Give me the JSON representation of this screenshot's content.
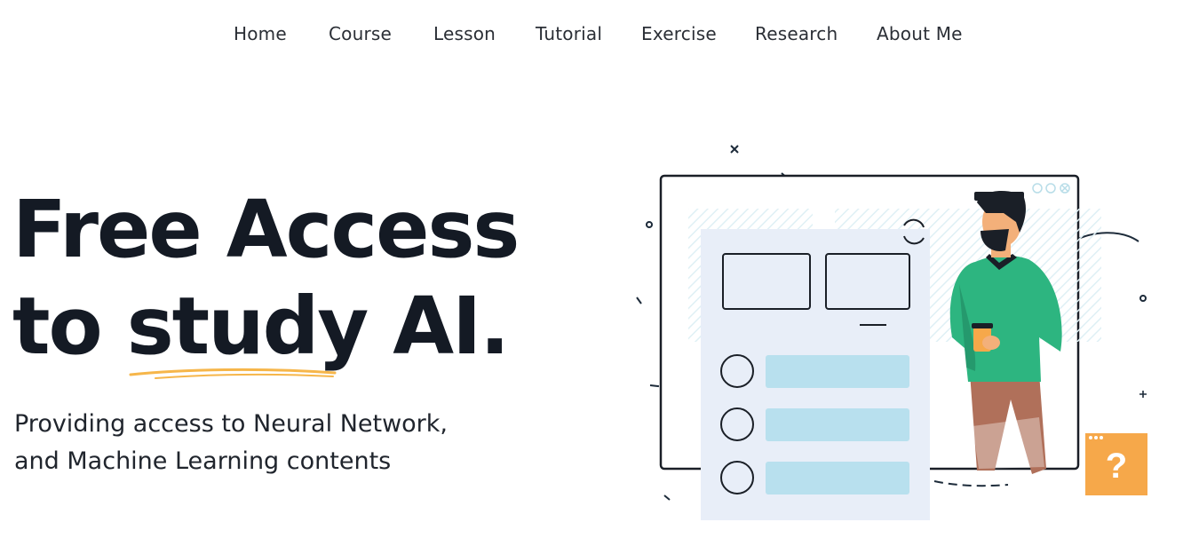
{
  "nav": {
    "items": [
      {
        "label": "Home"
      },
      {
        "label": "Course"
      },
      {
        "label": "Lesson"
      },
      {
        "label": "Tutorial"
      },
      {
        "label": "Exercise"
      },
      {
        "label": "Research"
      },
      {
        "label": "About Me"
      }
    ]
  },
  "hero": {
    "title_line1": "Free Access",
    "title_line2_prefix": "to ",
    "title_line2_highlight": "study",
    "title_line2_suffix": " AI.",
    "subtitle_line1": "Providing access to Neural Network,",
    "subtitle_line2": "and Machine Learning contents"
  },
  "illustration": {
    "help_badge": "?"
  },
  "colors": {
    "text_dark": "#141a24",
    "underline_accent": "#f6b64a",
    "panel_light": "#e8eef8",
    "bar_blue": "#b8e0ee",
    "shirt_green": "#2db580",
    "pants_brown": "#b0705a",
    "help_orange": "#f6a84a"
  }
}
